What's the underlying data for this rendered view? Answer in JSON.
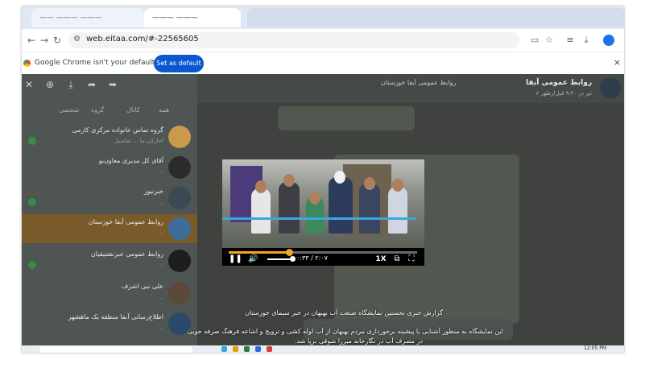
{
  "browser": {
    "tabs": [
      {
        "label": "—— ——— ———"
      },
      {
        "label": "——— ———"
      },
      {
        "label": ""
      }
    ],
    "url": "web.eitaa.com/#-22565605",
    "infobar": {
      "message": "Google Chrome isn't your default browser",
      "button": "Set as default",
      "close": "×"
    },
    "nav": {
      "back": "←",
      "forward": "→",
      "reload": "↻"
    }
  },
  "sidebar": {
    "folders": [
      "همه",
      "کانال",
      "گروه",
      "شخصی"
    ],
    "chats": [
      {
        "title": "گروه تماس خانواده مرکزی کارمی",
        "subtitle": "آجارکی ما ... تفاصیل",
        "color": "#c99a4a"
      },
      {
        "title": "آقای کل مدیری معاون‌بو",
        "subtitle": "...",
        "color": "#2b2b2b"
      },
      {
        "title": "خبرنیوز",
        "subtitle": "...",
        "color": "#3a4a55"
      },
      {
        "title": "روابط عمومی آبفا خوزستان",
        "subtitle": "...",
        "color": "#3d6c9a",
        "selected": true
      },
      {
        "title": "روابط عمومی خبرنشتیقیان",
        "subtitle": "...",
        "color": "#1d1d1d"
      },
      {
        "title": "علی نبی اشرف",
        "subtitle": "...",
        "color": "#5b4a3a"
      },
      {
        "title": "اطلاع‌رسانی آبفا منطقه یک ماهشهر",
        "subtitle": "...",
        "color": "#2a4a6a"
      }
    ]
  },
  "header": {
    "title": "روابط عمومی آبفا",
    "subtitle": "۶ تیر در ۹:۳۰ قبل‌ازظهر",
    "channel": "روابط عمومی آبفا خوزستان"
  },
  "video": {
    "time": "۰:۳۳ / ۲:۰۷",
    "speed": "1X",
    "progress": 0.32
  },
  "captions": {
    "line1": "گزارش خبری نخستین نمایشگاه صنعت آب بهبهان در خبر سیمای خوزستان",
    "line2": "این نمایشگاه به منظور آشنایی با پیشینه برخورداری مردم بهبهان از آب لوله کشی و ترویج و اشاعه فرهنگ صرفه جویی",
    "line3": "در مصرف آب در نگارخانه میرزا شوقی برپا شد."
  },
  "taskbar": {
    "clock": "12:05 PM"
  }
}
